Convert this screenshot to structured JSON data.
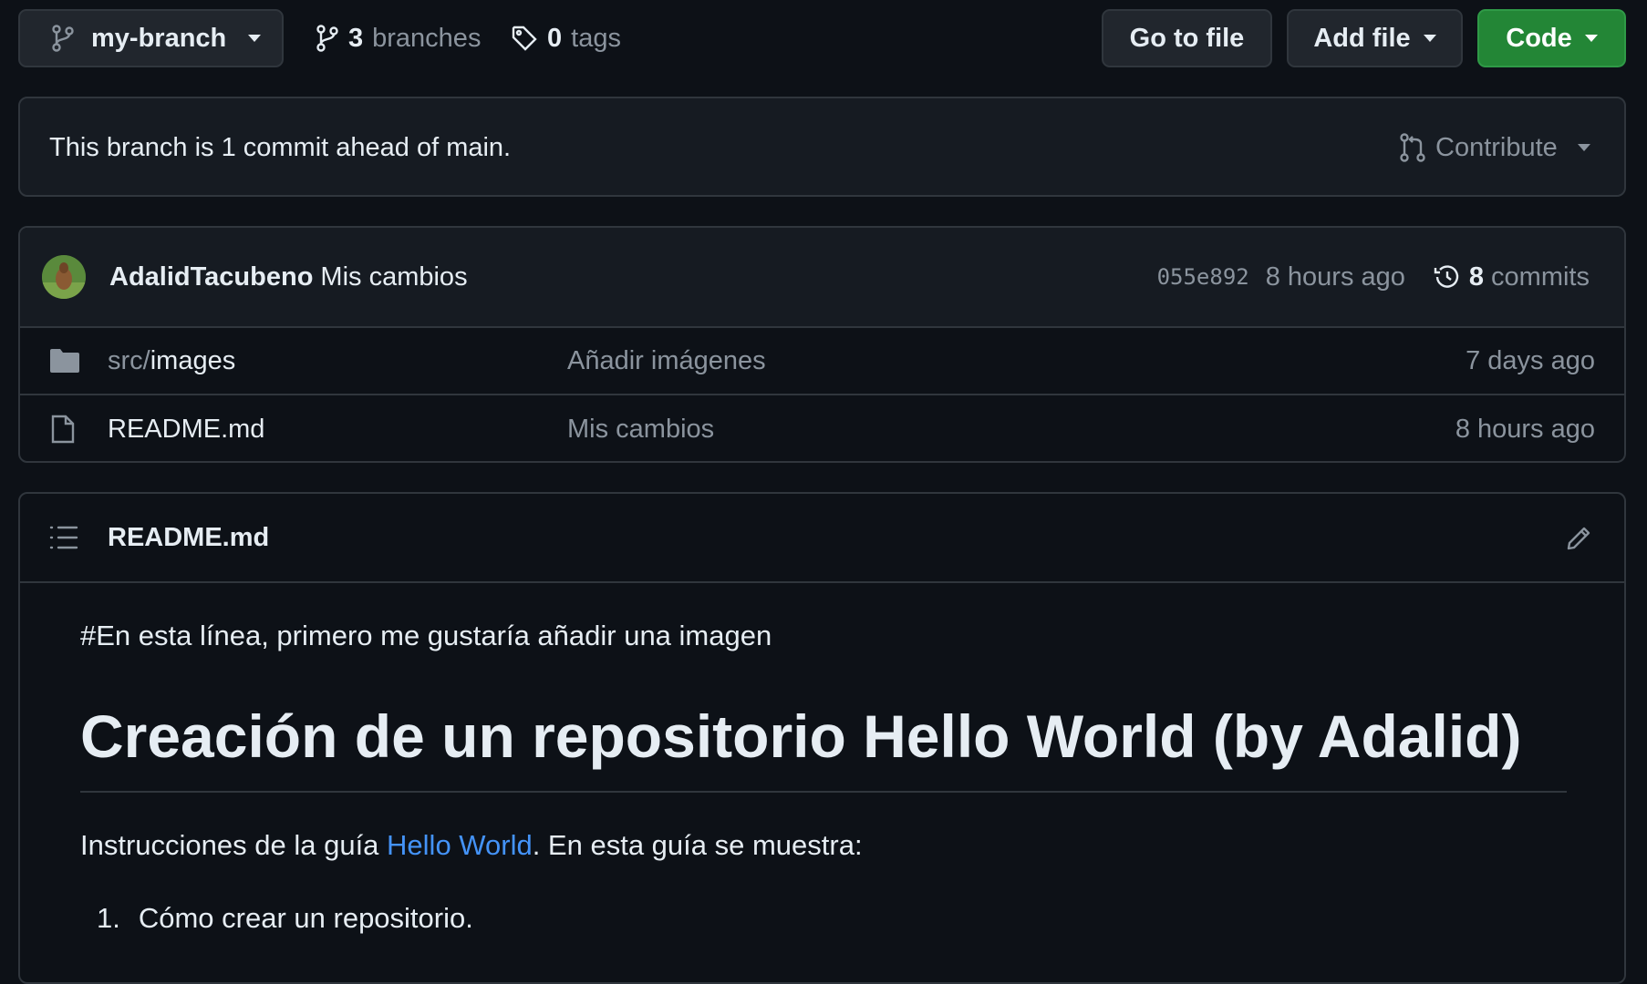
{
  "toolbar": {
    "branch_name": "my-branch",
    "branches_count": "3",
    "branches_label": "branches",
    "tags_count": "0",
    "tags_label": "tags",
    "go_to_file_label": "Go to file",
    "add_file_label": "Add file",
    "code_label": "Code"
  },
  "branch_status": {
    "message": "This branch is 1 commit ahead of main.",
    "contribute_label": "Contribute"
  },
  "latest_commit": {
    "author": "AdalidTacubeno",
    "message": "Mis cambios",
    "hash": "055e892",
    "time": "8 hours ago",
    "commits_count": "8",
    "commits_label": "commits"
  },
  "files": [
    {
      "name_prefix": "src/",
      "name": "images",
      "type": "folder",
      "commit_message": "Añadir imágenes",
      "time": "7 days ago"
    },
    {
      "name_prefix": "",
      "name": "README.md",
      "type": "file",
      "commit_message": "Mis cambios",
      "time": "8 hours ago"
    }
  ],
  "readme": {
    "filename": "README.md",
    "first_line": "#En esta línea, primero me gustaría añadir una imagen",
    "heading": "Creación de un repositorio Hello World (by Adalid)",
    "intro_before": "Instrucciones de la guía ",
    "intro_link": "Hello World",
    "intro_after": ". En esta guía se muestra:",
    "list": [
      {
        "number": "1.",
        "text": "Cómo crear un repositorio."
      }
    ]
  },
  "colors": {
    "background": "#0d1117",
    "border": "#30363d",
    "button_bg": "#21262d",
    "primary_green": "#238636",
    "link_blue": "#4493f8",
    "muted_text": "#8b949e"
  }
}
